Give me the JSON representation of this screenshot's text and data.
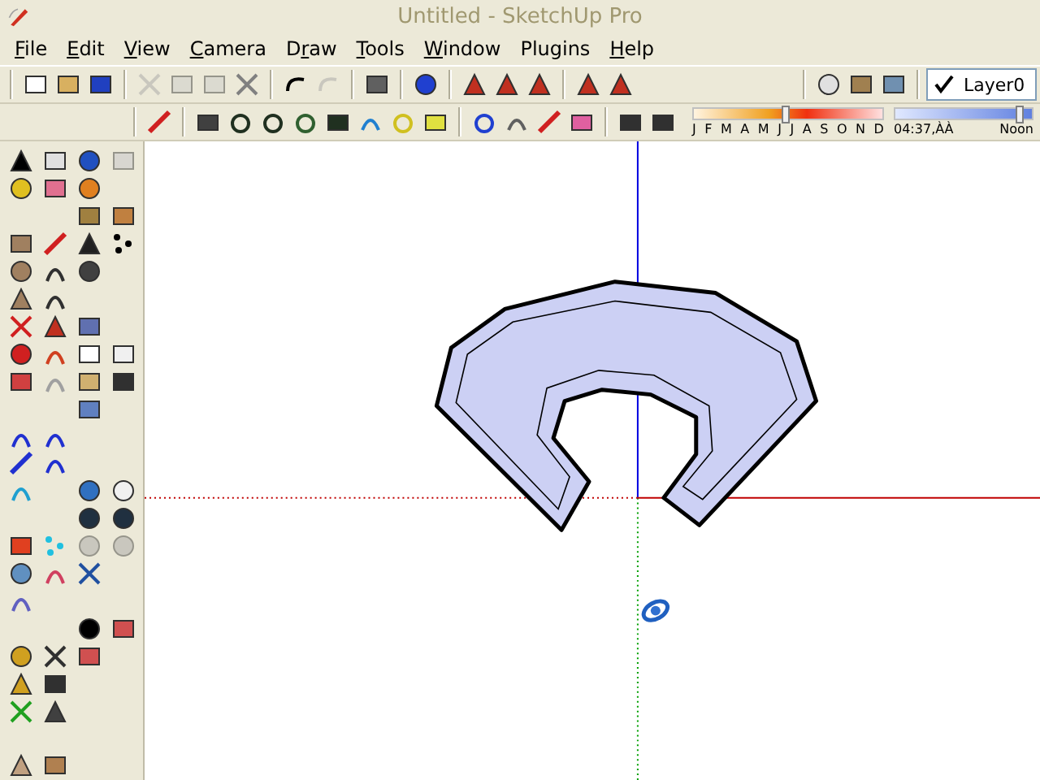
{
  "window": {
    "title": "Untitled - SketchUp Pro"
  },
  "menu": [
    {
      "key": "F",
      "post": "ile"
    },
    {
      "key": "E",
      "post": "dit"
    },
    {
      "key": "V",
      "post": "iew"
    },
    {
      "key": "C",
      "post": "amera"
    },
    {
      "pre": "D",
      "key": "r",
      "post": "aw"
    },
    {
      "key": "T",
      "post": "ools"
    },
    {
      "key": "W",
      "post": "indow"
    },
    {
      "pre": "Plugins"
    },
    {
      "key": "H",
      "post": "elp"
    }
  ],
  "layers": {
    "current": "Layer0",
    "checked": true
  },
  "shadows": {
    "months": [
      "J",
      "F",
      "M",
      "A",
      "M",
      "J",
      "J",
      "A",
      "S",
      "O",
      "N",
      "D"
    ],
    "date_slider": {
      "level": 0.48
    },
    "time": "04:37",
    "time_suffix": ",ÀÀ",
    "noon": "Noon",
    "time_slider": {
      "level": 0.9
    }
  }
}
